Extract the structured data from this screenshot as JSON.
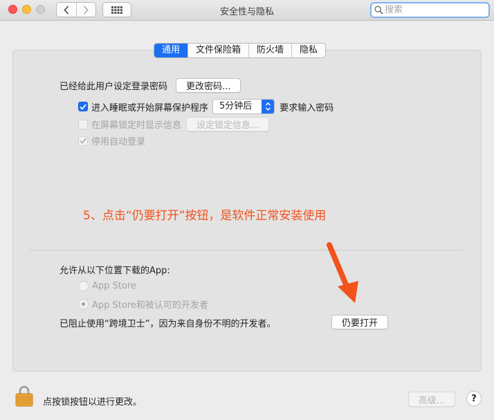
{
  "window": {
    "title": "安全性与隐私"
  },
  "search": {
    "placeholder": "搜索"
  },
  "tabs": [
    {
      "label": "通用",
      "active": true
    },
    {
      "label": "文件保险箱",
      "active": false
    },
    {
      "label": "防火墙",
      "active": false
    },
    {
      "label": "隐私",
      "active": false
    }
  ],
  "general": {
    "password_set_label": "已经给此用户设定登录密码",
    "change_password_button": "更改密码...",
    "require_password": {
      "checked": true,
      "label": "进入睡眠或开始屏幕保护程序",
      "delay_value": "5分钟后",
      "suffix": "要求输入密码"
    },
    "show_message": {
      "checked": false,
      "enabled": false,
      "label": "在屏幕锁定时显示信息",
      "button": "设定锁定信息..."
    },
    "disable_auto_login": {
      "checked": true,
      "enabled": false,
      "label": "停用自动登录"
    }
  },
  "annotation": "5、点击“仍要打开”按钮，是软件正常安装使用",
  "downloads": {
    "heading": "允许从以下位置下载的App:",
    "options": [
      {
        "label": "App Store",
        "selected": false
      },
      {
        "label": "App Store和被认可的开发者",
        "selected": true
      }
    ],
    "blocked_message": "已阻止使用“跨境卫士”，因为来自身份不明的开发者。",
    "open_anyway_button": "仍要打开"
  },
  "footer": {
    "lock_text": "点按锁按钮以进行更改。",
    "advanced_button": "高级...",
    "help_label": "?"
  },
  "colors": {
    "accent": "#1d6ff2",
    "annotation": "#f2521b",
    "lock": "#e7a23a"
  }
}
